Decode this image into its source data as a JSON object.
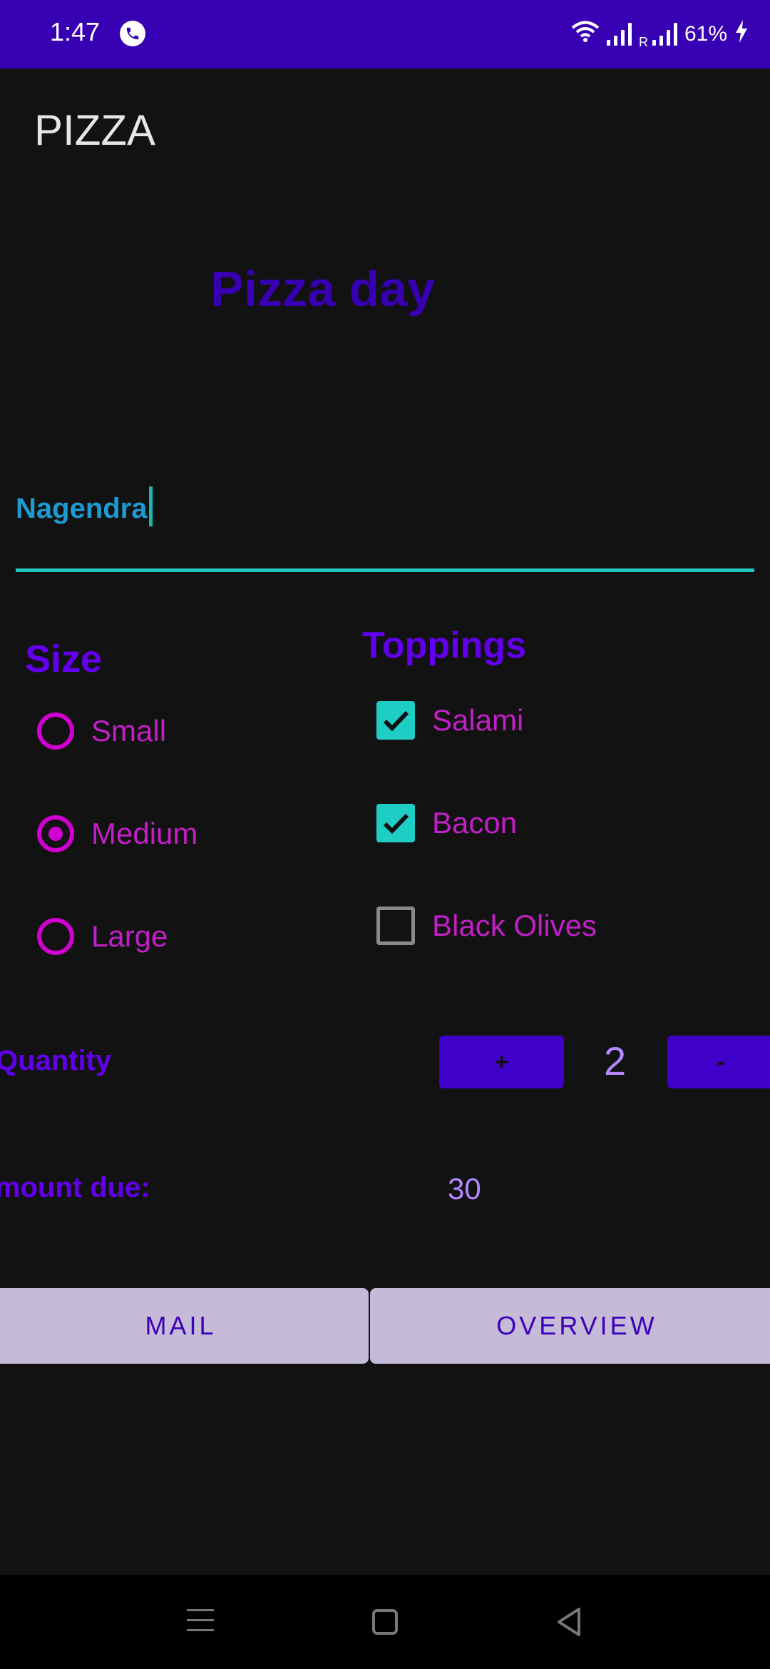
{
  "status_bar": {
    "time": "1:47",
    "call_icon": "phone-icon",
    "roaming": "R",
    "battery": "61%",
    "color": "#3700b3"
  },
  "app_bar": {
    "title": "PIZZA"
  },
  "heading": "Pizza day",
  "name_input": {
    "value": "Nagendra"
  },
  "size": {
    "heading": "Size",
    "options": [
      {
        "label": "Small",
        "selected": false
      },
      {
        "label": "Medium",
        "selected": true
      },
      {
        "label": "Large",
        "selected": false
      }
    ]
  },
  "toppings": {
    "heading": "Toppings",
    "items": [
      {
        "label": "Salami",
        "checked": true
      },
      {
        "label": "Bacon",
        "checked": true
      },
      {
        "label": "Black Olives",
        "checked": false
      }
    ]
  },
  "quantity": {
    "label": "Quantity",
    "plus_label": "+",
    "minus_label": "-",
    "value": "2"
  },
  "amount": {
    "label": "Amount due:",
    "value": "30"
  },
  "buttons": {
    "mail": "MAIL",
    "overview": "OVERVIEW"
  },
  "nav": {
    "menu_icon": "menu-icon",
    "home_icon": "home-icon",
    "back_icon": "back-icon"
  },
  "colors": {
    "background": "#121212",
    "primary": "#6200ee",
    "accent": "#d100d1",
    "teal": "#1ecec5"
  }
}
